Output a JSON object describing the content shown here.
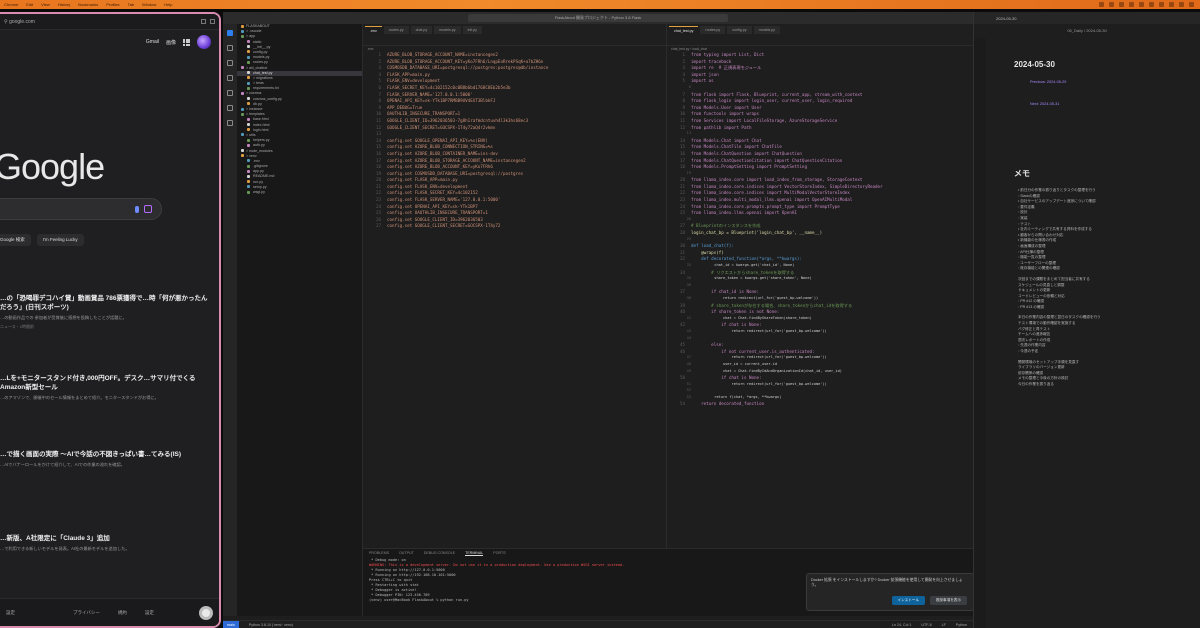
{
  "menubar": {
    "items": [
      "Chrome",
      "Edit",
      "View",
      "History",
      "Bookmarks",
      "Profiles",
      "Tab",
      "Window",
      "Help"
    ]
  },
  "chrome": {
    "url": "google.com",
    "top_links": [
      "Gmail",
      "画像"
    ],
    "logo": "Google",
    "buttons": [
      "Google 検索",
      "I'm Feeling Lucky"
    ],
    "news": [
      {
        "headline": "…の「恐喝罪デコハイ賞」動画賞品 786票獲得で…時「何が悪かったんだろう」(日刊スポーツ)",
        "body": "…の動画作品での 参加者が受賞後に感想を投稿したことが話題に。",
        "meta": "ニュース・2時間前"
      },
      {
        "headline": "…Lを+モニタースタンド付き,000円OFF。デスク…サマリ付でくる Amazon新型セール",
        "body": "…のアマゾンで、開催中のセール情報をまとめて紹介。モニタースタンドがお得に。",
        "meta": ""
      },
      {
        "headline": "…で描く画面の実際 〜AIで今話の不図きっぱい書…てみる(IS)",
        "body": "…AIでバナーロールをかけて紹介して、AIでの作業の流れを確認。",
        "meta": ""
      },
      {
        "headline": "…新版、A社限定に「Claude 3」追加",
        "body": "…で利用できる新しいモデルを発表。AI社の最新モデルを追加した。",
        "meta": ""
      }
    ],
    "footer": [
      "設定",
      "プライバシー",
      "規約",
      "設定"
    ]
  },
  "vscode": {
    "title": "FlaskAbout 開発プロジェクト - Python 3.8 Flask",
    "explorer": [
      "FLASKABOUT",
      "> .vscode",
      "> app",
      "  static",
      "  __init__.py",
      "  config.py",
      "  models.py",
      "  routes.py",
      "> aiii_chatbot",
      "  chat_test.py",
      "  > migrations",
      "  > tests",
      "  requirements.txt",
      "> cosmos",
      "  cosmos_config.py",
      "  db.py",
      "> instance",
      "> templates",
      "  base.html",
      "  index.html",
      "  login.html",
      "> utils",
      "  helpers.py",
      "  auth.py",
      "> node_modules",
      "> venv",
      "  .env",
      "  .gitignore",
      "  app.py",
      "  README.md",
      "  run.py",
      "  setup.py",
      "  wsgi.py"
    ],
    "left_tabs": [
      ".env",
      "routes.py",
      "chat.py",
      "models.py",
      "init.py"
    ],
    "right_tabs": [
      "chat_test.py",
      "routes.py",
      "config.py",
      "models.py"
    ],
    "left_code": [
      "AZURE_BLOB_STORAGE_ACCOUNT_NAME=instancegen2",
      "AZURE_BLOB_STORAGE_ACCOUNT_KEY=yKo7FRh6/LnqpEnRrekPSqK+a7bZH6n",
      "COSMOSDB_DATABASE_URI=postgresql://postgres:postgres@db/instance",
      "FLASK_APP=main.py",
      "FLASK_ENV=development",
      "FLASK_SECRET_KEY=4c102152c0c0B8b6bd1768C8Eb2b5e3b",
      "FLASK_SERVER_NAME='127.0.0.1:5000'",
      "OPENAI_API_KEY=sk-YTk1BP7RMBB9UV4EXT3BlbkFJ",
      "APP_DEBUG=True",
      "OAUTHLIB_INSECURE_TRANSPORT=1",
      "GOOGLE_CLIENT_ID=3962036503-7g8h1rafmdcntuvh4l3k3hs68ec3",
      "GOOGLE_CLIENT_SECRET=GOCSPX-1T4y72aQ4r2vkmv",
      "",
      "config.set GOOGLE_OPENAI_API_KEY=%s(ENV)",
      "config.set AZURE_BLOB_CONNECTION_STRING=%s",
      "config.set AZURE_BLOB_CONTAINER_NAME=ins-dev",
      "config.set AZURE_BLOB_STORAGE_ACCOUNT_NAME=instancegen2",
      "config.set AZURE_BLOB_ACCOUNT_KEY=yKo7FRh6",
      "config.set COSMOSDB_DATABASE_URI=postgresql://postgres",
      "config.set FLASK_APP=main.py",
      "config.set FLASK_ENV=development",
      "config.set FLASK_SECRET_KEY=4c102152",
      "config.set FLASK_SERVER_NAME='127.0.0.1:5000'",
      "config.set OPENAI_API_KEY=sk-YTk1BP7",
      "config.set OAUTHLIB_INSECURE_TRANSPORT=1",
      "config.set GOOGLE_CLIENT_ID=3962036503",
      "config.set GOOGLE_CLIENT_SECRET=GOCSPX-1T4y72"
    ],
    "right_code": [
      [
        "kw",
        "from typing import List, Dict"
      ],
      [
        "kw",
        "import traceback"
      ],
      [
        "kw",
        "import re  # 正規表現モジュール"
      ],
      [
        "kw",
        "import json"
      ],
      [
        "kw",
        "import os"
      ],
      [
        "pl",
        ""
      ],
      [
        "kw",
        "from flask import Flask, Blueprint, current_app, stream_with_context"
      ],
      [
        "kw",
        "from flask_login import login_user, current_user, login_required"
      ],
      [
        "kw",
        "from Models.User import User"
      ],
      [
        "kw",
        "from functools import wraps"
      ],
      [
        "kw",
        "from Services import LocalFileStorage, AzureStorageService"
      ],
      [
        "kw",
        "from pathlib import Path"
      ],
      [
        "pl",
        ""
      ],
      [
        "kw",
        "from Models.Chat import Chat"
      ],
      [
        "kw",
        "from Models.ChatFile import ChatFile"
      ],
      [
        "kw",
        "from Models.ChatQuestion import ChatQuestion"
      ],
      [
        "kw",
        "from Models.ChatQuestionCitation import ChatQuestionCitation"
      ],
      [
        "kw",
        "from Models.PromptSetting import PromptSetting"
      ],
      [
        "pl",
        ""
      ],
      [
        "kw",
        "from llama_index.core import load_index_from_storage, StorageContext"
      ],
      [
        "kw",
        "from llama_index.core.indices import VectorStoreIndex, SimpleDirectoryReader"
      ],
      [
        "kw",
        "from llama_index.core.indices import MultiModalVectorStoreIndex"
      ],
      [
        "kw",
        "from llama_index.multi_modal_llms.openai import OpenAIMultiModal"
      ],
      [
        "kw",
        "from llama_index.core.prompts.prompt_type import PromptType"
      ],
      [
        "kw",
        "from llama_index.llms.openai import OpenAI"
      ],
      [
        "pl",
        ""
      ],
      [
        "cm",
        "# Blueprintのインスタンスを作成"
      ],
      [
        "fn",
        "login_chat_bp = Blueprint('login_chat_bp', __name__)"
      ],
      [
        "pl",
        ""
      ],
      [
        "bl",
        "def load_chat(f):"
      ],
      [
        "fn",
        "    @wraps(f)"
      ],
      [
        "bl",
        "    def decorated_function(*args, **kwargs):"
      ],
      [
        "pl",
        "        chat_id = kwargs.get('chat_id', None)"
      ],
      [
        "cm",
        "        # リクエストからshare_tokenを取得する"
      ],
      [
        "pl",
        "        share_token = kwargs.get('share_token', None)"
      ],
      [
        "pl",
        ""
      ],
      [
        "kw",
        "        if chat_id is None:"
      ],
      [
        "pl",
        "            return redirect(url_for('guest_bp.welcome'))"
      ],
      [
        "cm",
        "        # share_tokenが存在する場合、share_tokenからchat_idを取得する"
      ],
      [
        "kw",
        "        if share_token is not None:"
      ],
      [
        "pl",
        "            chat = Chat.findByShareToken(share_token)"
      ],
      [
        "kw",
        "            if chat is None:"
      ],
      [
        "pl",
        "                return redirect(url_for('guest_bp.welcome'))"
      ],
      [
        "pl",
        ""
      ],
      [
        "kw",
        "        else:"
      ],
      [
        "kw",
        "            if not current_user.is_authenticated:"
      ],
      [
        "pl",
        "                return redirect(url_for('guest_bp.welcome'))"
      ],
      [
        "pl",
        "            user_id = current_user.id"
      ],
      [
        "pl",
        "            chat = Chat.findByIdAndOrganizationId(chat_id, user_id)"
      ],
      [
        "kw",
        "            if chat is None:"
      ],
      [
        "pl",
        "                return redirect(url_for('guest_bp.welcome'))"
      ],
      [
        "pl",
        ""
      ],
      [
        "pl",
        "        return f(chat, *args, **kwargs)"
      ],
      [
        "kw",
        "    return decorated_function"
      ]
    ],
    "panel_tabs": [
      "PROBLEMS",
      "OUTPUT",
      "DEBUG CONSOLE",
      "TERMINAL",
      "PORTS"
    ],
    "terminal": [
      [
        "pl",
        " * Debug mode: on"
      ],
      [
        "red",
        "WARNING: This is a development server. Do not use it in a production deployment. Use a production WSGI server instead."
      ],
      [
        "pl",
        " * Running on http://127.0.0.1:5000"
      ],
      [
        "pl",
        " * Running on http://192.168.10.101:5000"
      ],
      [
        "pl",
        "Press CTRL+C to quit"
      ],
      [
        "pl",
        " * Restarting with stat"
      ],
      [
        "pl",
        " * Debugger is active!"
      ],
      [
        "pl",
        " * Debugger PIN: 123-456-789"
      ],
      [
        "pl",
        "(venv) user@MacBook FlaskAbout % python run.py"
      ]
    ],
    "toast": {
      "text": "Docker 拡張 をインストールしますか? Docker 拡張機能を使用して開発を向上させましょう。",
      "primary": "インストール",
      "secondary": "推奨事項を表示"
    },
    "status": {
      "branch": "main",
      "items": [
        "Python 3.8.10 ('venv': venv)",
        "Ln 24, Col 1",
        "UTF-8",
        "LF",
        "Python"
      ]
    }
  },
  "obsidian": {
    "tab": "2024-05-30",
    "header": "05_Daily / 2024-05-30",
    "date": "2024-05-30",
    "links": [
      "Previous: 2024-05-29",
      "Next: 2024-05-31"
    ],
    "memo_title": "メモ",
    "lines": [
      "• 前日分の作業の振り返りとタスクの整理を行う",
      "  ◦ Slackの確認",
      "• 自社サービスのアップデート進捗について確認",
      "  ◦ 要件定義",
      "  ◦ 設計",
      "  ◦ 実装",
      "  ◦ テスト",
      "• 社内ミーティングで共有する資料を作成する",
      "• 顧客からの問い合わせ対応",
      "• 新機能の仕様書の作成",
      "  ◦ 画面構成の整理",
      "  ◦ API仕様の整理",
      "  ◦ 機能一覧の整理",
      "  ◦ ユーザーフローの整理",
      "  ◦ 既存機能との関連の確認",
      "次回までの課題をまとめて担当者に共有する",
      "スケジュールの見直しと調整",
      "ドキュメントの更新",
      "コードレビューの依頼と対応",
      "  ◦ PR #12 の確認",
      "  ◦ PR #13 の確認",
      "本日の作業内容の整理と翌日のタスクの確認を行う",
      "テスト環境での動作確認を実施する",
      "バグ修正と再テスト",
      "チームへの進捗報告",
      "週次レポートの作成",
      "  ◦ 先週の作業内容",
      "  ◦ 今週の予定",
      "開発環境のセットアップ手順を見直す",
      "ライブラリのバージョン更新",
      "依存関係の確認",
      "メモの整理と今後の方針の検討",
      "今日の作業を振り返る"
    ]
  }
}
